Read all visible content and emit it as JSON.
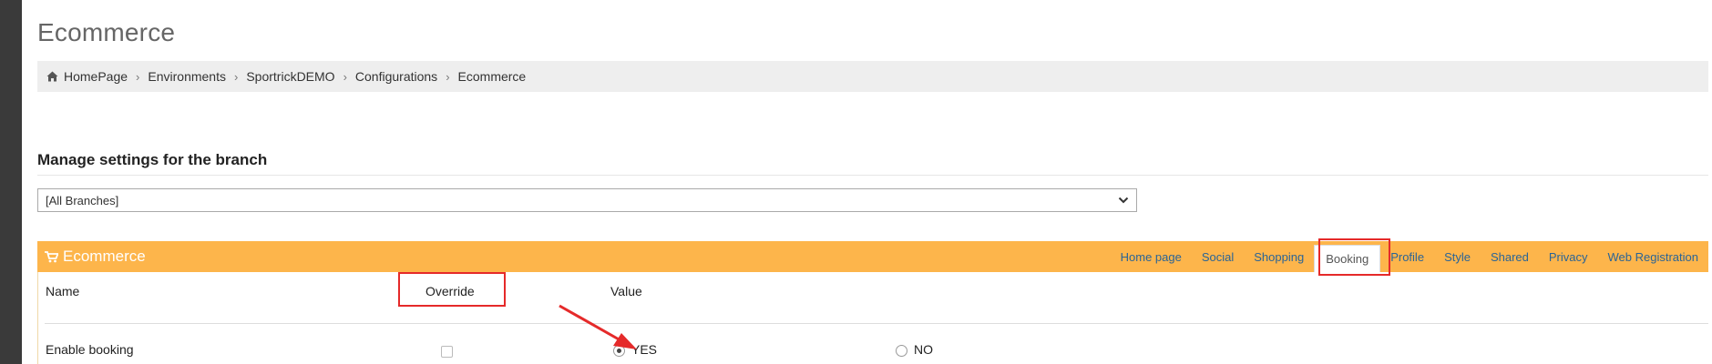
{
  "page": {
    "title": "Ecommerce"
  },
  "breadcrumb": {
    "items": [
      "HomePage",
      "Environments",
      "SportrickDEMO",
      "Configurations",
      "Ecommerce"
    ],
    "separator": "›"
  },
  "branch_settings": {
    "heading": "Manage settings for the branch",
    "selected_branch": "[All Branches]"
  },
  "panel": {
    "title": "Ecommerce",
    "header_color": "#fdb54b",
    "tabs": [
      "Home page",
      "Social",
      "Shopping",
      "Booking",
      "Profile",
      "Style",
      "Shared",
      "Privacy",
      "Web Registration"
    ],
    "active_tab": "Booking"
  },
  "table": {
    "columns": {
      "name": "Name",
      "override": "Override",
      "value": "Value"
    },
    "rows": [
      {
        "name": "Enable booking",
        "override": false,
        "options": [
          "YES",
          "NO"
        ],
        "selected": "YES"
      }
    ]
  },
  "annotation_color": "#e52a2a"
}
